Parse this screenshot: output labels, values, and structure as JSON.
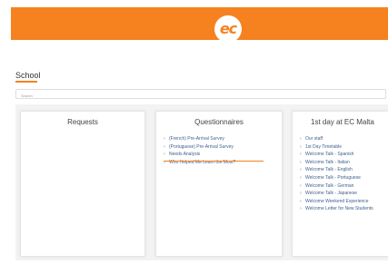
{
  "header": {
    "logo_text": "ec",
    "brand_color": "#f5821f"
  },
  "section": {
    "title": "School"
  },
  "search": {
    "placeholder": "Search"
  },
  "cards": [
    {
      "title": "Requests",
      "items": []
    },
    {
      "title": "Questionnaires",
      "items": [
        "(French) Pre-Arrival Survey",
        "(Portuguese) Pre-Arrival Survey",
        "Needs Analysis",
        "Who Helped Me Learn the Most?"
      ]
    },
    {
      "title": "1st day at EC Malta",
      "items": [
        "Our staff",
        "1st Day Timetable",
        "Welcome Talk - Spanish",
        "Welcome Talk - Italian",
        "Welcome Talk - English",
        "Welcome Talk - Portuguese",
        "Welcome Talk - German",
        "Welcome Talk - Japanese",
        "Welcome Weekend Experience",
        "Welcome Letter for New Students"
      ]
    }
  ]
}
